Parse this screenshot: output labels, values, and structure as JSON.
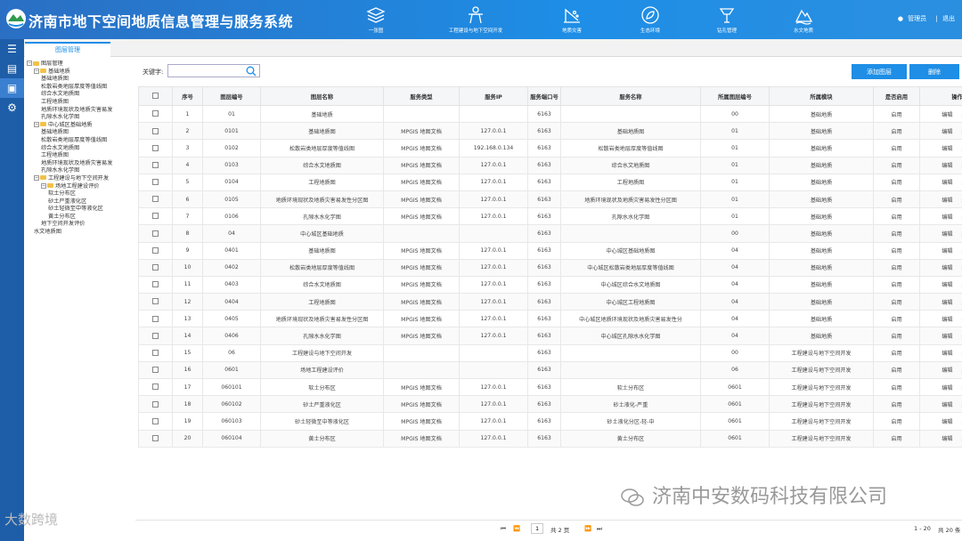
{
  "app": {
    "title": "济南市地下空间地质信息管理与服务系统"
  },
  "topnav": [
    {
      "label": "一张图",
      "icon": "layers-icon"
    },
    {
      "label": "工程建设与地下空间开发",
      "icon": "worker-icon"
    },
    {
      "label": "地质灾害",
      "icon": "landslide-icon"
    },
    {
      "label": "生态环境",
      "icon": "leaf-icon"
    },
    {
      "label": "钻孔管理",
      "icon": "drill-icon"
    },
    {
      "label": "水文地质",
      "icon": "water-icon"
    }
  ],
  "user": {
    "name": "管理员",
    "logout": "退出"
  },
  "tab": {
    "label": "图层管理"
  },
  "tree": [
    {
      "label": "图层管理",
      "level": 0,
      "type": "folder"
    },
    {
      "label": "基础地质",
      "level": 1,
      "type": "folder"
    },
    {
      "label": "基础地质图",
      "level": 2,
      "type": "leaf"
    },
    {
      "label": "松散岩类地层厚度等值线图",
      "level": 2,
      "type": "leaf"
    },
    {
      "label": "综合水文地质图",
      "level": 2,
      "type": "leaf"
    },
    {
      "label": "工程地质图",
      "level": 2,
      "type": "leaf"
    },
    {
      "label": "地质环境现状及地质灾害易发",
      "level": 2,
      "type": "leaf"
    },
    {
      "label": "孔隙水水化学图",
      "level": 2,
      "type": "leaf"
    },
    {
      "label": "中心城区基础地质",
      "level": 1,
      "type": "folder"
    },
    {
      "label": "基础地质图",
      "level": 2,
      "type": "leaf"
    },
    {
      "label": "松散岩类地层厚度等值线图",
      "level": 2,
      "type": "leaf"
    },
    {
      "label": "综合水文地质图",
      "level": 2,
      "type": "leaf"
    },
    {
      "label": "工程地质图",
      "level": 2,
      "type": "leaf"
    },
    {
      "label": "地质环境现状及地质灾害易发",
      "level": 2,
      "type": "leaf"
    },
    {
      "label": "孔隙水水化学图",
      "level": 2,
      "type": "leaf"
    },
    {
      "label": "工程建设与地下空间开发",
      "level": 1,
      "type": "folder"
    },
    {
      "label": "场地工程建设评价",
      "level": 2,
      "type": "folder"
    },
    {
      "label": "软土分布区",
      "level": 3,
      "type": "leaf"
    },
    {
      "label": "砂土严重液化区",
      "level": 3,
      "type": "leaf"
    },
    {
      "label": "砂土轻微至中等液化区",
      "level": 3,
      "type": "leaf"
    },
    {
      "label": "黄土分布区",
      "level": 3,
      "type": "leaf"
    },
    {
      "label": "地下空间开发评价",
      "level": 2,
      "type": "leaf"
    },
    {
      "label": "水文地质图",
      "level": 1,
      "type": "leaf"
    }
  ],
  "search": {
    "label": "关键字:",
    "value": ""
  },
  "buttons": {
    "add": "添加图层",
    "delete": "删除"
  },
  "table": {
    "headers": [
      "序号",
      "图层编号",
      "图层名称",
      "服务类型",
      "服务IP",
      "服务端口号",
      "服务名称",
      "所属图层编号",
      "所属模块",
      "是否启用",
      "操作"
    ],
    "edit": "编辑",
    "remove": "删除",
    "rows": [
      [
        "1",
        "01",
        "基础地质",
        "",
        "",
        "6163",
        "",
        "00",
        "基础地质",
        "启用"
      ],
      [
        "2",
        "0101",
        "基础地质图",
        "MPGIS 地图文档",
        "127.0.0.1",
        "6163",
        "基础地质图",
        "01",
        "基础地质",
        "启用"
      ],
      [
        "3",
        "0102",
        "松散岩类地层厚度等值线图",
        "MPGIS 地图文档",
        "192.168.0.134",
        "6163",
        "松散岩类地层厚度等值线图",
        "01",
        "基础地质",
        "启用"
      ],
      [
        "4",
        "0103",
        "综合水文地质图",
        "MPGIS 地图文档",
        "127.0.0.1",
        "6163",
        "综合水文地质图",
        "01",
        "基础地质",
        "启用"
      ],
      [
        "5",
        "0104",
        "工程地质图",
        "MPGIS 地图文档",
        "127.0.0.1",
        "6163",
        "工程地质图",
        "01",
        "基础地质",
        "启用"
      ],
      [
        "6",
        "0105",
        "地质环境现状及地质灾害易发性分区图",
        "MPGIS 地图文档",
        "127.0.0.1",
        "6163",
        "地质环境现状及地质灾害易发性分区图",
        "01",
        "基础地质",
        "启用"
      ],
      [
        "7",
        "0106",
        "孔隙水水化学图",
        "MPGIS 地图文档",
        "127.0.0.1",
        "6163",
        "孔隙水水化学图",
        "01",
        "基础地质",
        "启用"
      ],
      [
        "8",
        "04",
        "中心城区基础地质",
        "",
        "",
        "6163",
        "",
        "00",
        "基础地质",
        "启用"
      ],
      [
        "9",
        "0401",
        "基础地质图",
        "MPGIS 地图文档",
        "127.0.0.1",
        "6163",
        "中心城区基础地质图",
        "04",
        "基础地质",
        "启用"
      ],
      [
        "10",
        "0402",
        "松散岩类地层厚度等值线图",
        "MPGIS 地图文档",
        "127.0.0.1",
        "6163",
        "中心城区松散岩类地层厚度等值线图",
        "04",
        "基础地质",
        "启用"
      ],
      [
        "11",
        "0403",
        "综合水文地质图",
        "MPGIS 地图文档",
        "127.0.0.1",
        "6163",
        "中心城区综合水文地质图",
        "04",
        "基础地质",
        "启用"
      ],
      [
        "12",
        "0404",
        "工程地质图",
        "MPGIS 地图文档",
        "127.0.0.1",
        "6163",
        "中心城区工程地质图",
        "04",
        "基础地质",
        "启用"
      ],
      [
        "13",
        "0405",
        "地质环境现状及地质灾害易发性分区图",
        "MPGIS 地图文档",
        "127.0.0.1",
        "6163",
        "中心城区地质环境现状及地质灾害易发性分",
        "04",
        "基础地质",
        "启用"
      ],
      [
        "14",
        "0406",
        "孔隙水水化学图",
        "MPGIS 地图文档",
        "127.0.0.1",
        "6163",
        "中心城区孔隙水水化学图",
        "04",
        "基础地质",
        "启用"
      ],
      [
        "15",
        "06",
        "工程建设与地下空间开发",
        "",
        "",
        "6163",
        "",
        "00",
        "工程建设与地下空间开发",
        "启用"
      ],
      [
        "16",
        "0601",
        "场地工程建设评价",
        "",
        "",
        "6163",
        "",
        "06",
        "工程建设与地下空间开发",
        "启用"
      ],
      [
        "17",
        "060101",
        "软土分布区",
        "MPGIS 地图文档",
        "127.0.0.1",
        "6163",
        "软土分布区",
        "0601",
        "工程建设与地下空间开发",
        "启用"
      ],
      [
        "18",
        "060102",
        "砂土严重液化区",
        "MPGIS 地图文档",
        "127.0.0.1",
        "6163",
        "砂土液化-严重",
        "0601",
        "工程建设与地下空间开发",
        "启用"
      ],
      [
        "19",
        "060103",
        "砂土轻微至中等液化区",
        "MPGIS 地图文档",
        "127.0.0.1",
        "6163",
        "砂土液化分区-轻-中",
        "0601",
        "工程建设与地下空间开发",
        "启用"
      ],
      [
        "20",
        "060104",
        "黄土分布区",
        "MPGIS 地图文档",
        "127.0.0.1",
        "6163",
        "黄土分布区",
        "0601",
        "工程建设与地下空间开发",
        "启用"
      ]
    ]
  },
  "pager": {
    "page": "1",
    "total_pages": "共 2 页",
    "range": "1 - 20",
    "total": "共 20 条"
  },
  "watermark": {
    "company": "济南中安数码科技有限公司",
    "corner": "大数跨境"
  }
}
